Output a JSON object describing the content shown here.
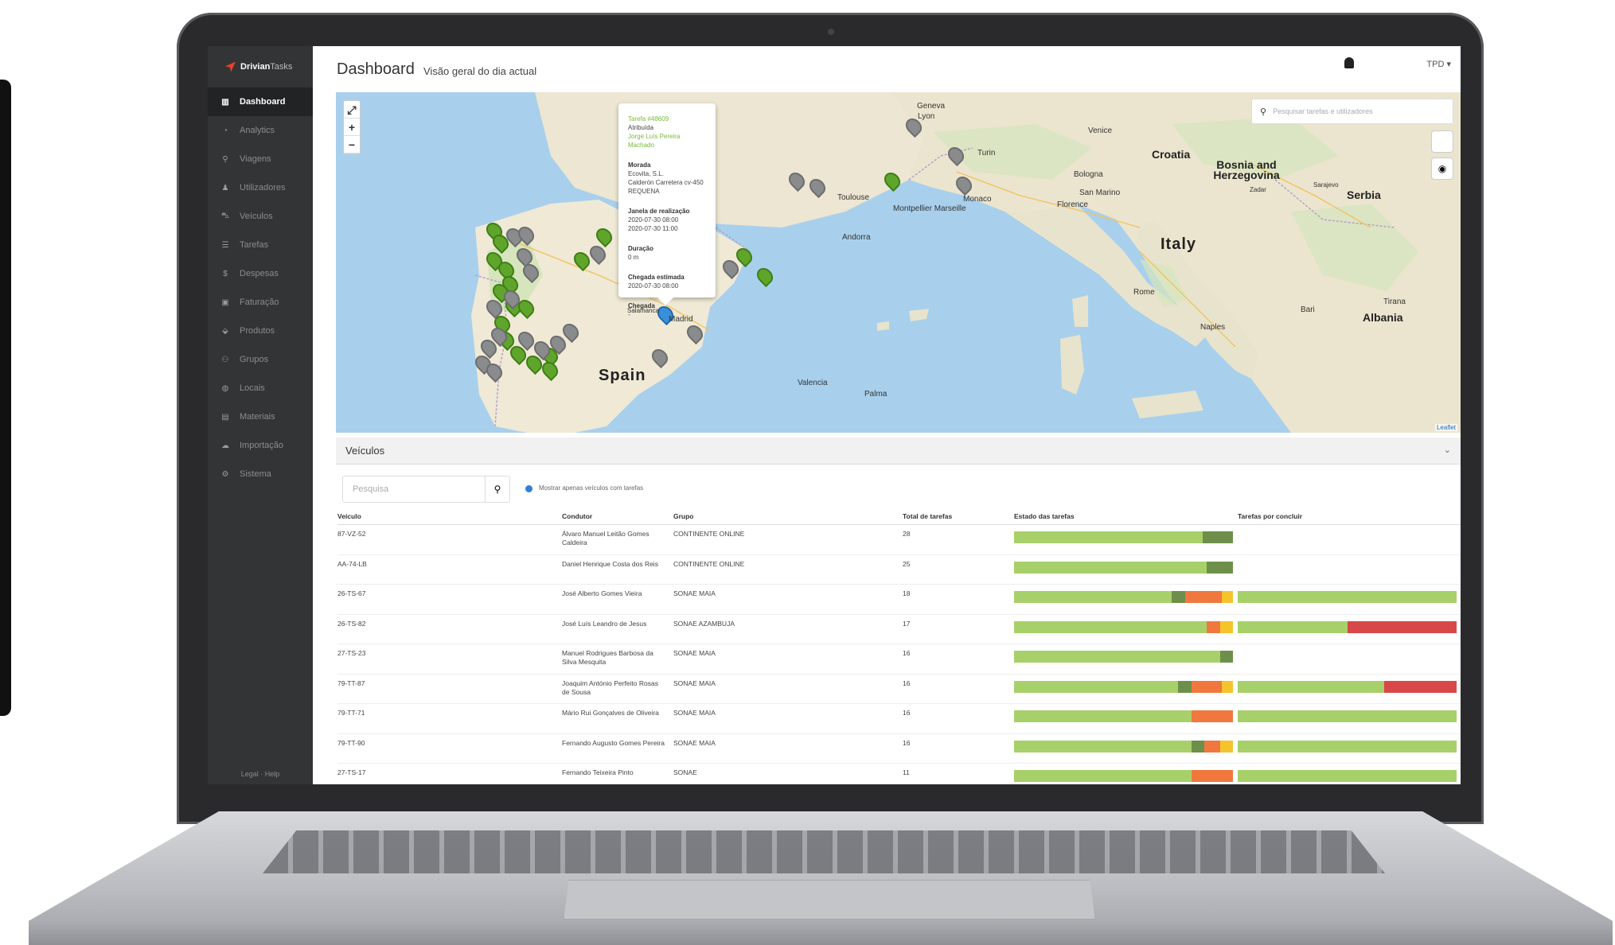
{
  "sidebar": {
    "logo_brand": "Drivian",
    "logo_suffix": "Tasks",
    "items": [
      {
        "icon": "chart-icon",
        "label": "Dashboard"
      },
      {
        "icon": "pie-icon",
        "label": "Analytics"
      },
      {
        "icon": "pin-icon",
        "label": "Viagens"
      },
      {
        "icon": "user-icon",
        "label": "Utilizadores"
      },
      {
        "icon": "car-icon",
        "label": "Veículos"
      },
      {
        "icon": "list-icon",
        "label": "Tarefas"
      },
      {
        "icon": "dollar-icon",
        "label": "Despesas"
      },
      {
        "icon": "invoice-icon",
        "label": "Faturação"
      },
      {
        "icon": "tag-icon",
        "label": "Produtos"
      },
      {
        "icon": "group-icon",
        "label": "Grupos"
      },
      {
        "icon": "globe-icon",
        "label": "Locais"
      },
      {
        "icon": "box-icon",
        "label": "Materiais"
      },
      {
        "icon": "cloud-icon",
        "label": "Importação"
      },
      {
        "icon": "gear-icon",
        "label": "Sistema"
      }
    ],
    "footer": "Legal · Help"
  },
  "header": {
    "title": "Dashboard",
    "subtitle": "Visão geral do dia actual",
    "user": "TPD ▾"
  },
  "map": {
    "search_placeholder": "Pesquisar tarefas e utilizadores",
    "attribution": "Leaflet",
    "labels": {
      "spain": "Spain",
      "italy": "Italy",
      "croatia": "Croatia",
      "bosnia": "Bosnia and Herzegovina",
      "serbia": "Serbia",
      "albania": "Albania",
      "geneva": "Geneva",
      "lyon": "Lyon",
      "turin": "Turin",
      "venice": "Venice",
      "bologna": "Bologna",
      "florence": "Florence",
      "san_marino": "San Marino",
      "monaco": "Monaco",
      "marseille": "Montpellier Marseille",
      "toulouse": "Toulouse",
      "andorra": "Andorra",
      "madrid": "Madrid",
      "salamanca": "Salamanca",
      "rome": "Rome",
      "naples": "Naples",
      "bari": "Bari",
      "tirana": "Tirana",
      "palma": "Palma",
      "sarajevo": "Sarajevo",
      "zadar": "Zadar",
      "valencia": "Valencia"
    },
    "popup": {
      "task": "Tarefa #48609",
      "status": "Atribuída",
      "driver": "Jorge Luís Pereira Machado",
      "address_label": "Morada",
      "address": "Ecovita, S.L.\nCalderón Carretera cv-450\nREQUENA",
      "window_label": "Janela de realização",
      "window_start": "2020-07-30 08:00",
      "window_end": "2020-07-30 11:00",
      "duration_label": "Duração",
      "duration": "0 m",
      "eta_label": "Chegada estimada",
      "eta": "2020-07-30 08:00",
      "arrival_label": "Chegada",
      "arrival": "-"
    }
  },
  "vehicles": {
    "title": "Veículos",
    "search_placeholder": "Pesquisa",
    "checkbox_label": "Mostrar apenas veículos com tarefas",
    "columns": [
      "Veículo",
      "Condutor",
      "Grupo",
      "Total de tarefas",
      "Estado das tarefas",
      "Tarefas por concluir"
    ],
    "colors": {
      "done": "#a8d06a",
      "dark": "#6e8f4a",
      "orange": "#f0783e",
      "yellow": "#f5c42c",
      "red": "#d84848"
    },
    "rows": [
      {
        "vehicle": "87-VZ-52",
        "driver": "Álvaro Manuel Leitão Gomes Caldeira",
        "group": "CONTINENTE ONLINE",
        "total": "28",
        "state": [
          [
            0.86,
            "done"
          ],
          [
            0.14,
            "dark"
          ]
        ],
        "pending": []
      },
      {
        "vehicle": "AA-74-LB",
        "driver": "Daniel Henrique Costa dos Reis",
        "group": "CONTINENTE ONLINE",
        "total": "25",
        "state": [
          [
            0.88,
            "done"
          ],
          [
            0.12,
            "dark"
          ]
        ],
        "pending": []
      },
      {
        "vehicle": "26-TS-67",
        "driver": "José Alberto Gomes Vieira",
        "group": "SONAE MAIA",
        "total": "18",
        "state": [
          [
            0.72,
            "done"
          ],
          [
            0.06,
            "dark"
          ],
          [
            0.17,
            "orange"
          ],
          [
            0.05,
            "yellow"
          ]
        ],
        "pending": [
          [
            1.0,
            "done"
          ]
        ]
      },
      {
        "vehicle": "26-TS-82",
        "driver": "José Luís Leandro de Jesus",
        "group": "SONAE AZAMBUJA",
        "total": "17",
        "state": [
          [
            0.88,
            "done"
          ],
          [
            0.06,
            "orange"
          ],
          [
            0.06,
            "yellow"
          ]
        ],
        "pending": [
          [
            0.5,
            "done"
          ],
          [
            0.5,
            "red"
          ]
        ]
      },
      {
        "vehicle": "27-TS-23",
        "driver": "Manuel Rodrigues Barbosa da Silva Mesquita",
        "group": "SONAE MAIA",
        "total": "16",
        "state": [
          [
            0.94,
            "done"
          ],
          [
            0.06,
            "dark"
          ]
        ],
        "pending": []
      },
      {
        "vehicle": "79-TT-87",
        "driver": "Joaquim António Perfeito Rosas de Sousa",
        "group": "SONAE MAIA",
        "total": "16",
        "state": [
          [
            0.75,
            "done"
          ],
          [
            0.06,
            "dark"
          ],
          [
            0.14,
            "orange"
          ],
          [
            0.05,
            "yellow"
          ]
        ],
        "pending": [
          [
            0.67,
            "done"
          ],
          [
            0.33,
            "red"
          ]
        ]
      },
      {
        "vehicle": "79-TT-71",
        "driver": "Mário Rui Gonçalves de Oliveira",
        "group": "SONAE MAIA",
        "total": "16",
        "state": [
          [
            0.81,
            "done"
          ],
          [
            0.19,
            "orange"
          ]
        ],
        "pending": [
          [
            1.0,
            "done"
          ]
        ]
      },
      {
        "vehicle": "79-TT-90",
        "driver": "Fernando Augusto Gomes Pereira",
        "group": "SONAE MAIA",
        "total": "16",
        "state": [
          [
            0.81,
            "done"
          ],
          [
            0.06,
            "dark"
          ],
          [
            0.07,
            "orange"
          ],
          [
            0.06,
            "yellow"
          ]
        ],
        "pending": [
          [
            1.0,
            "done"
          ]
        ]
      },
      {
        "vehicle": "27-TS-17",
        "driver": "Fernando Teixeira Pinto",
        "group": "SONAE",
        "total": "11",
        "state": [
          [
            0.81,
            "done"
          ],
          [
            0.19,
            "orange"
          ]
        ],
        "pending": [
          [
            1.0,
            "done"
          ]
        ]
      }
    ]
  }
}
